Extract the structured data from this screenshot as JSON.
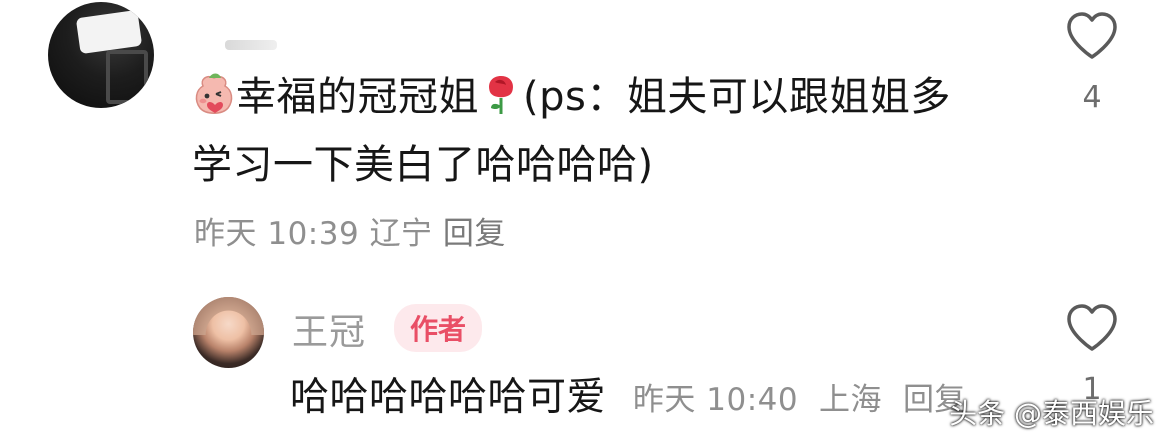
{
  "comment": {
    "text_line1": "幸福的冠冠姐",
    "text_line1_rest": "(ps：姐夫可以跟姐姐多",
    "text_line2": "学习一下美白了哈哈哈哈)",
    "time": "昨天 10:39",
    "location": "辽宁",
    "reply_label": "回复",
    "like_count": "4",
    "emoji_icons": [
      "peach-face-emoji",
      "rose-emoji"
    ]
  },
  "reply": {
    "author_name": "王冠",
    "author_badge": "作者",
    "text": "哈哈哈哈哈哈可爱",
    "time": "昨天 10:40",
    "location": "上海",
    "reply_label": "回复",
    "like_count": "1"
  },
  "watermark": {
    "text": "头条 @泰西娱乐"
  },
  "colors": {
    "text": "#161616",
    "meta": "#8f8f8f",
    "badge_bg": "#fde9ec",
    "badge_text": "#e94f66",
    "heart_stroke": "#5a5a5a"
  }
}
